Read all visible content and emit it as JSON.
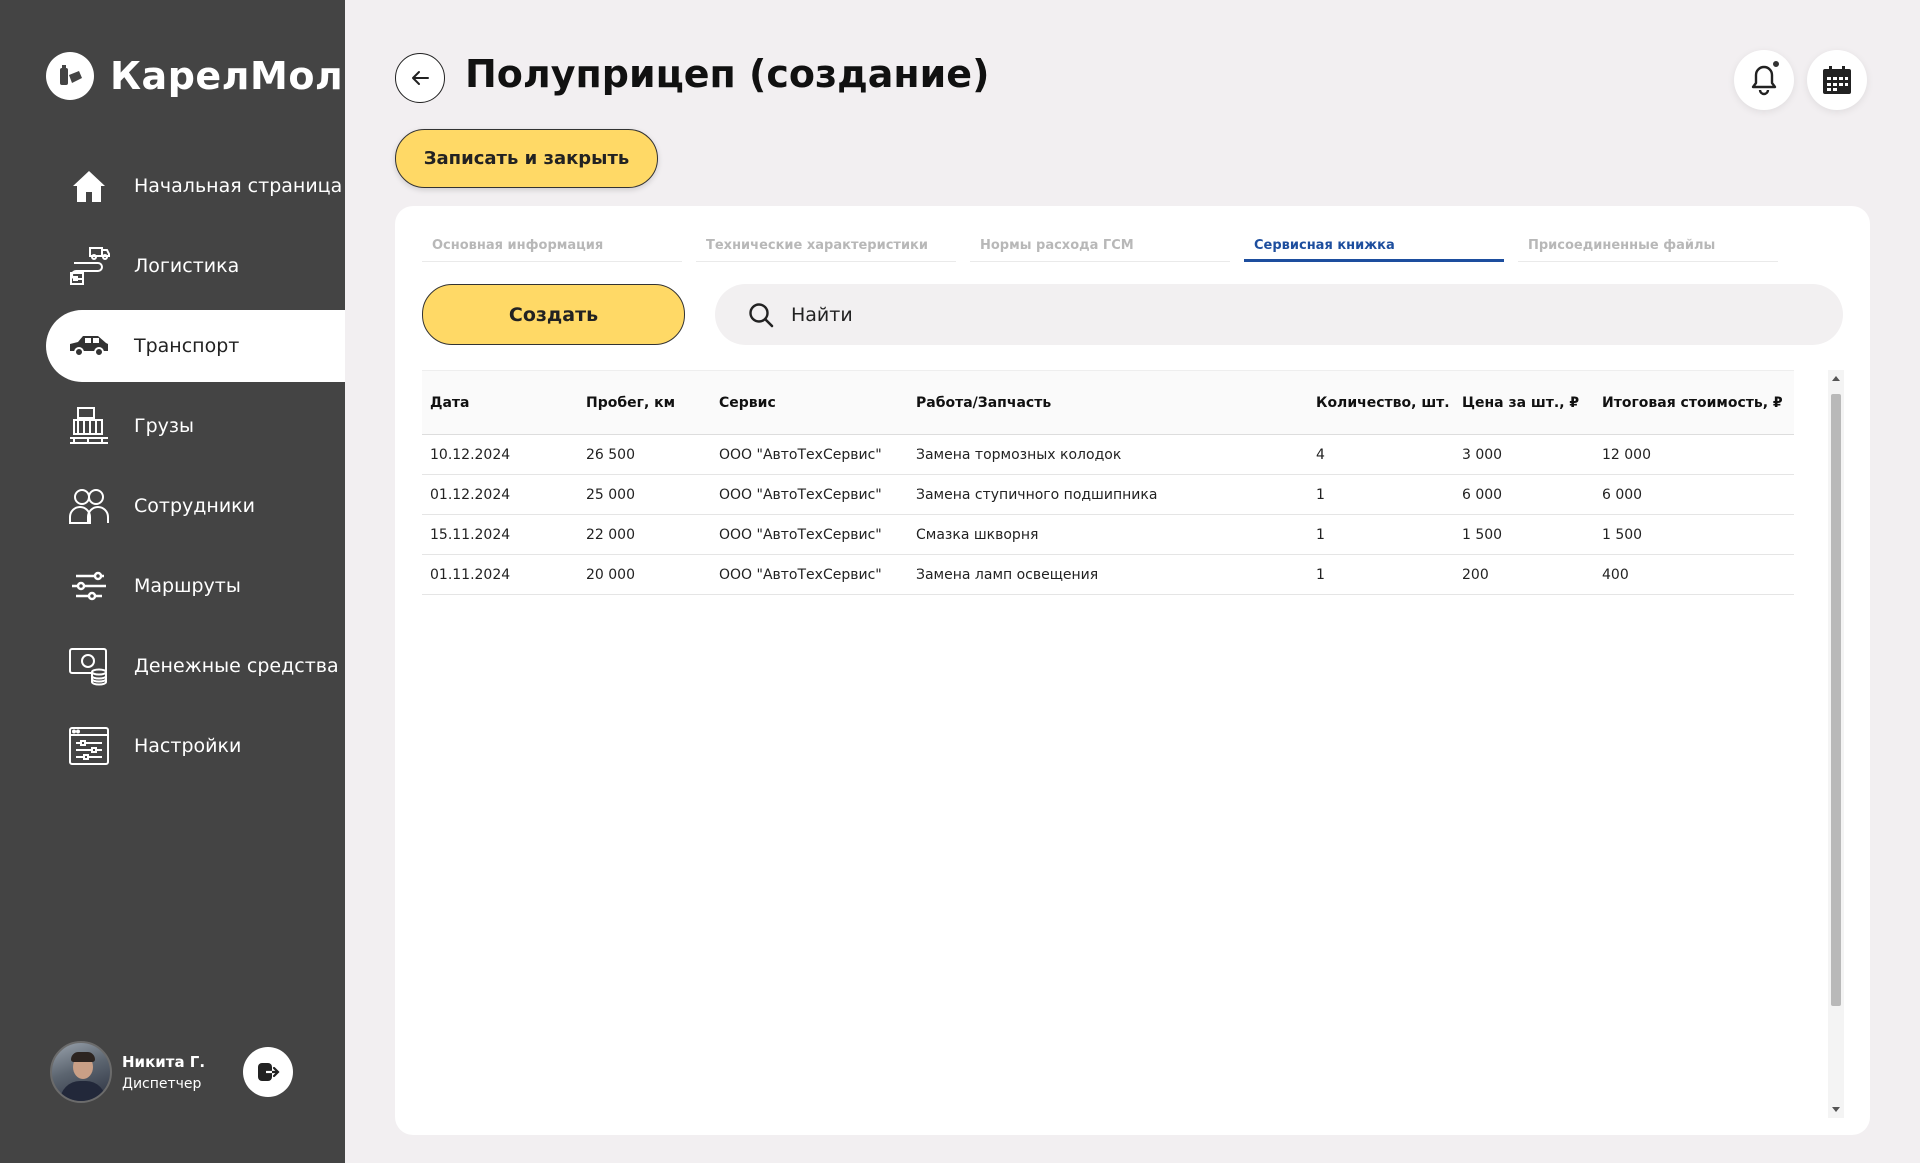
{
  "brand": {
    "name": "КарелМол"
  },
  "sidebar": {
    "items": [
      {
        "label": "Начальная страница",
        "icon": "home-icon"
      },
      {
        "label": "Логистика",
        "icon": "logistics-icon"
      },
      {
        "label": "Транспорт",
        "icon": "truck-icon",
        "active": true
      },
      {
        "label": "Грузы",
        "icon": "cargo-icon"
      },
      {
        "label": "Сотрудники",
        "icon": "employees-icon"
      },
      {
        "label": "Маршруты",
        "icon": "routes-icon"
      },
      {
        "label": "Денежные средства",
        "icon": "money-icon"
      },
      {
        "label": "Настройки",
        "icon": "settings-icon"
      }
    ]
  },
  "user": {
    "name": "Никита Г.",
    "role": "Диспетчер"
  },
  "header": {
    "title": "Полуприцеп (создание)"
  },
  "toolbar": {
    "save_close_label": "Записать и закрыть"
  },
  "tabs": [
    {
      "label": "Основная информация"
    },
    {
      "label": "Технические характеристики"
    },
    {
      "label": "Нормы расхода ГСМ"
    },
    {
      "label": "Сервисная книжка",
      "active": true
    },
    {
      "label": "Присоединенные файлы"
    }
  ],
  "service": {
    "create_label": "Создать",
    "search_placeholder": "Найти",
    "columns": [
      "Дата",
      "Пробег, км",
      "Сервис",
      "Работа/Запчасть",
      "Количество, шт.",
      "Цена за шт., ₽",
      "Итоговая стоимость, ₽"
    ],
    "rows": [
      [
        "10.12.2024",
        "26 500",
        "ООО \"АвтоТехСервис\"",
        "Замена тормозных колодок",
        "4",
        "3 000",
        "12 000"
      ],
      [
        "01.12.2024",
        "25 000",
        "ООО \"АвтоТехСервис\"",
        "Замена ступичного подшипника",
        "1",
        "6 000",
        "6 000"
      ],
      [
        "15.11.2024",
        "22 000",
        "ООО \"АвтоТехСервис\"",
        "Смазка шкворня",
        "1",
        "1 500",
        "1 500"
      ],
      [
        "01.11.2024",
        "20 000",
        "ООО \"АвтоТехСервис\"",
        "Замена ламп освещения",
        "1",
        "200",
        "400"
      ]
    ]
  },
  "colors": {
    "sidebar_bg": "#444444",
    "accent_yellow": "#ffd966",
    "active_tab": "#1d4e9e",
    "page_bg": "#f2eff1"
  }
}
